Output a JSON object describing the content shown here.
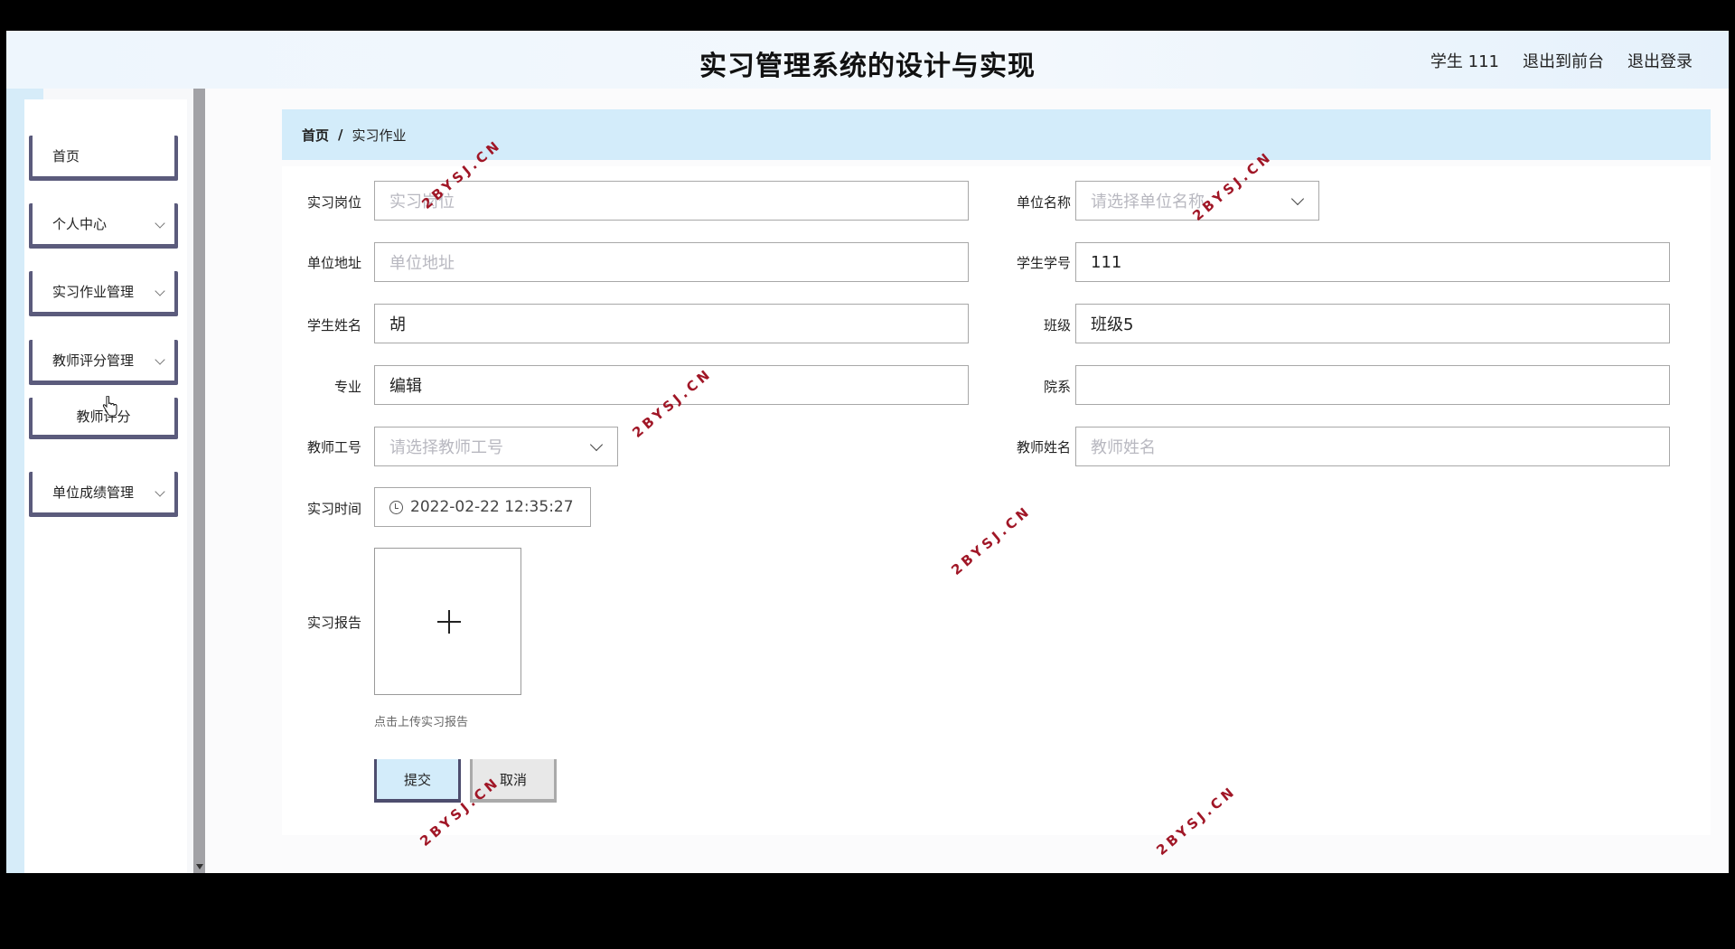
{
  "header": {
    "title": "实习管理系统的设计与实现",
    "user": "学生 111",
    "back_to_front": "退出到前台",
    "logout": "退出登录"
  },
  "sidebar": {
    "items": [
      {
        "label": "首页"
      },
      {
        "label": "个人中心"
      },
      {
        "label": "实习作业管理"
      },
      {
        "label": "教师评分管理"
      },
      {
        "label": "教师评分"
      },
      {
        "label": "单位成绩管理"
      }
    ]
  },
  "breadcrumb": {
    "home": "首页",
    "separator": "/",
    "current": "实习作业"
  },
  "form": {
    "position": {
      "label": "实习岗位",
      "value": "",
      "placeholder": "实习岗位"
    },
    "unit_name": {
      "label": "单位名称",
      "value": "",
      "placeholder": "请选择单位名称"
    },
    "unit_address": {
      "label": "单位地址",
      "value": "",
      "placeholder": "单位地址"
    },
    "student_id": {
      "label": "学生学号",
      "value": "111"
    },
    "student_name": {
      "label": "学生姓名",
      "value": "胡"
    },
    "class": {
      "label": "班级",
      "value": "班级5"
    },
    "major": {
      "label": "专业",
      "value": "编辑"
    },
    "department": {
      "label": "院系",
      "value": ""
    },
    "teacher_id": {
      "label": "教师工号",
      "value": "",
      "placeholder": "请选择教师工号"
    },
    "teacher_name": {
      "label": "教师姓名",
      "value": "",
      "placeholder": "教师姓名"
    },
    "internship_time": {
      "label": "实习时间",
      "value": "2022-02-22 12:35:27"
    },
    "report": {
      "label": "实习报告",
      "hint": "点击上传实习报告"
    },
    "submit_label": "提交",
    "cancel_label": "取消"
  },
  "watermark": "2BYSJ.CN"
}
